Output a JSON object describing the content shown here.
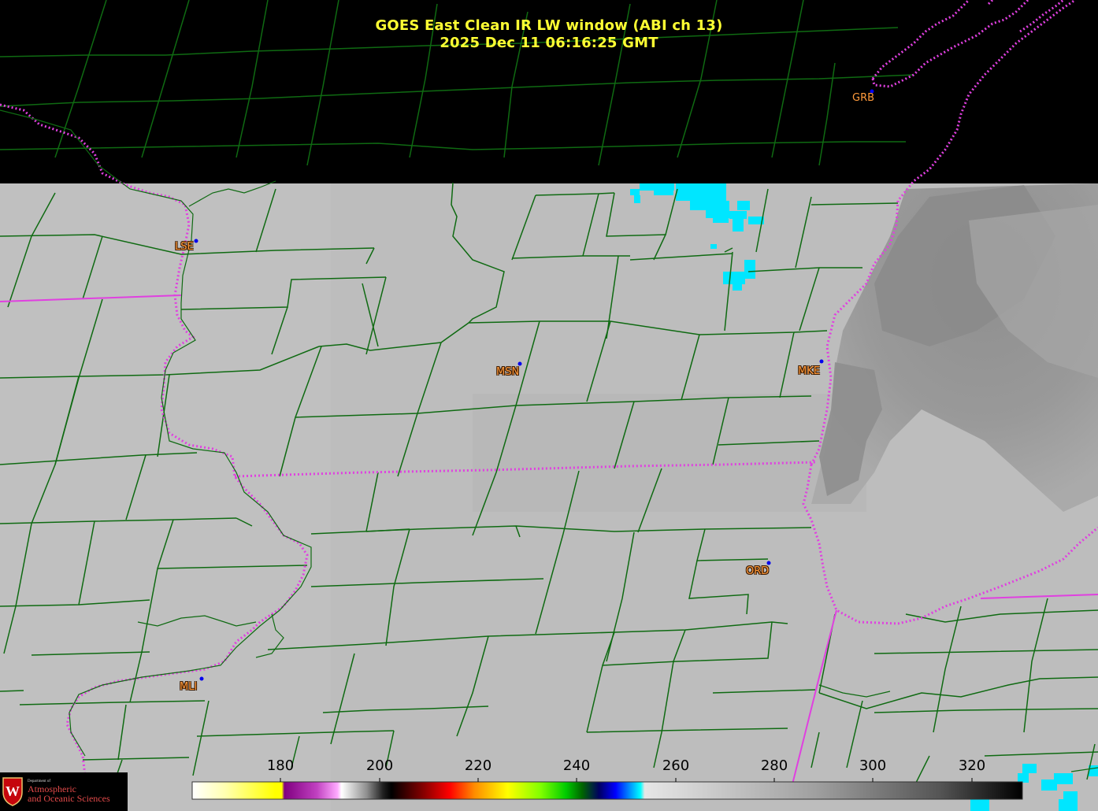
{
  "title": {
    "line1": "GOES East Clean IR LW window (ABI ch 13)",
    "line2": "2025 Dec 11  06:16:25 GMT",
    "color": "#ffff33"
  },
  "stations": [
    {
      "id": "GRB",
      "label": "GRB"
    },
    {
      "id": "LSE",
      "label": "LSE"
    },
    {
      "id": "MSN",
      "label": "MSN"
    },
    {
      "id": "MKE",
      "label": "MKE"
    },
    {
      "id": "ORD",
      "label": "ORD"
    },
    {
      "id": "MLI",
      "label": "MLI"
    }
  ],
  "colorbar": {
    "ticks": [
      "180",
      "200",
      "220",
      "240",
      "260",
      "280",
      "300",
      "320"
    ],
    "range_k": [
      163,
      330
    ]
  },
  "logo": {
    "dept_text": "Department of",
    "line1": "Atmospheric",
    "line2": "and Oceanic Sciences",
    "seal_letter": "W"
  },
  "colors": {
    "background_dark": "#000000",
    "land_gray": "#bdbdbd",
    "county_lines": "#0f6a12",
    "state_borders": "#e040e0",
    "cold_cloud_cyan": "#00e6ff",
    "lake_dark_gray": "#8c8c8c"
  }
}
